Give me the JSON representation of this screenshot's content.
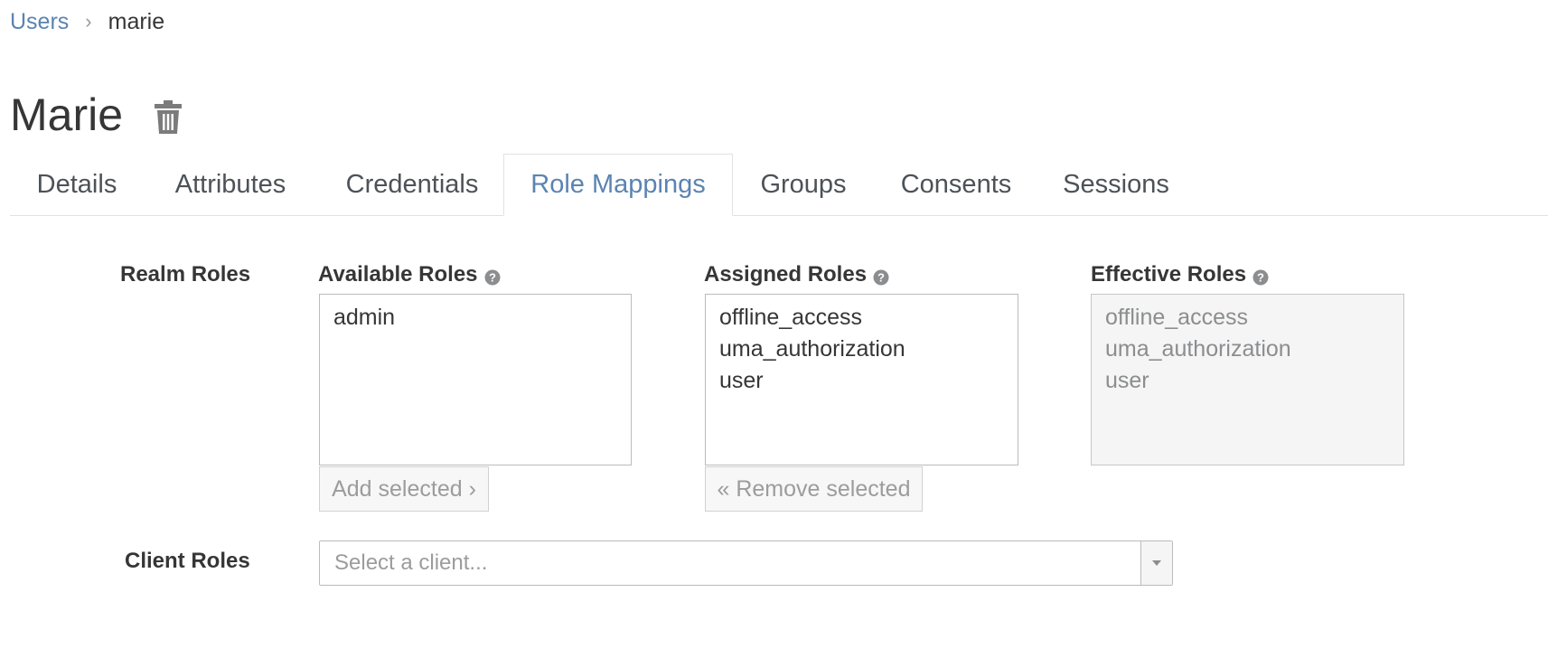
{
  "breadcrumb": {
    "parent": "Users",
    "separator": "›",
    "current": "marie"
  },
  "page": {
    "title": "Marie",
    "delete_icon": "trash-icon"
  },
  "tabs": [
    {
      "label": "Details",
      "active": false
    },
    {
      "label": "Attributes",
      "active": false
    },
    {
      "label": "Credentials",
      "active": false
    },
    {
      "label": "Role Mappings",
      "active": true
    },
    {
      "label": "Groups",
      "active": false
    },
    {
      "label": "Consents",
      "active": false
    },
    {
      "label": "Sessions",
      "active": false
    }
  ],
  "realm_roles": {
    "label": "Realm Roles",
    "available": {
      "label": "Available Roles",
      "options": [
        "admin"
      ],
      "button_label": "Add selected ›"
    },
    "assigned": {
      "label": "Assigned Roles",
      "options": [
        "offline_access",
        "uma_authorization",
        "user"
      ],
      "button_label": "« Remove selected"
    },
    "effective": {
      "label": "Effective Roles",
      "options": [
        "offline_access",
        "uma_authorization",
        "user"
      ]
    }
  },
  "client_roles": {
    "label": "Client Roles",
    "select_placeholder": "Select a client..."
  },
  "colors": {
    "link": "#5b84b1",
    "text": "#363636",
    "muted": "#9c9c9c",
    "border": "#bbbbbb"
  }
}
